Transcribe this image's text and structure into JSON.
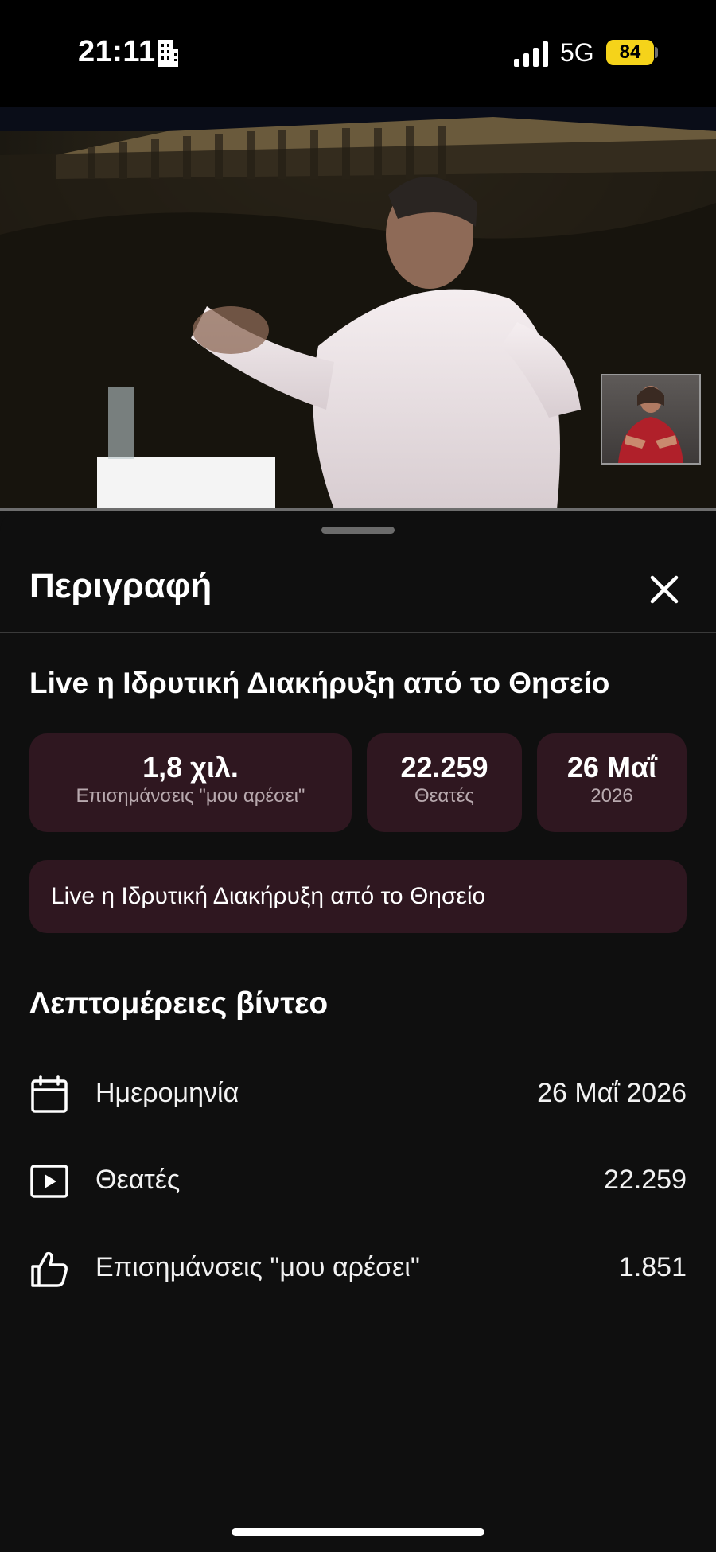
{
  "status_bar": {
    "time": "21:11",
    "network": "5G",
    "battery": "84",
    "battery_color": "#f5d31a"
  },
  "video": {
    "icons": [
      "building-icon"
    ]
  },
  "sheet": {
    "title": "Περιγραφή",
    "video_title": "Live η Ιδρυτική Διακήρυξη από το Θησείο",
    "stats": {
      "likes": {
        "value": "1,8 χιλ.",
        "label": "Επισημάνσεις \"μου αρέσει\""
      },
      "viewers": {
        "value": "22.259",
        "label": "Θεατές"
      },
      "date": {
        "value": "26 Μαΐ",
        "label": "2026"
      }
    },
    "description": "Live η Ιδρυτική Διακήρυξη από το Θησείο",
    "details_heading": "Λεπτομέρειες βίντεο",
    "details": [
      {
        "icon": "calendar-icon",
        "label": "Ημερομηνία",
        "value": "26 Μαΐ 2026"
      },
      {
        "icon": "play-icon",
        "label": "Θεατές",
        "value": "22.259"
      },
      {
        "icon": "thumbs-up-icon",
        "label": "Επισημάνσεις \"μου αρέσει\"",
        "value": "1.851"
      }
    ],
    "accent_color": "#2f1720"
  }
}
